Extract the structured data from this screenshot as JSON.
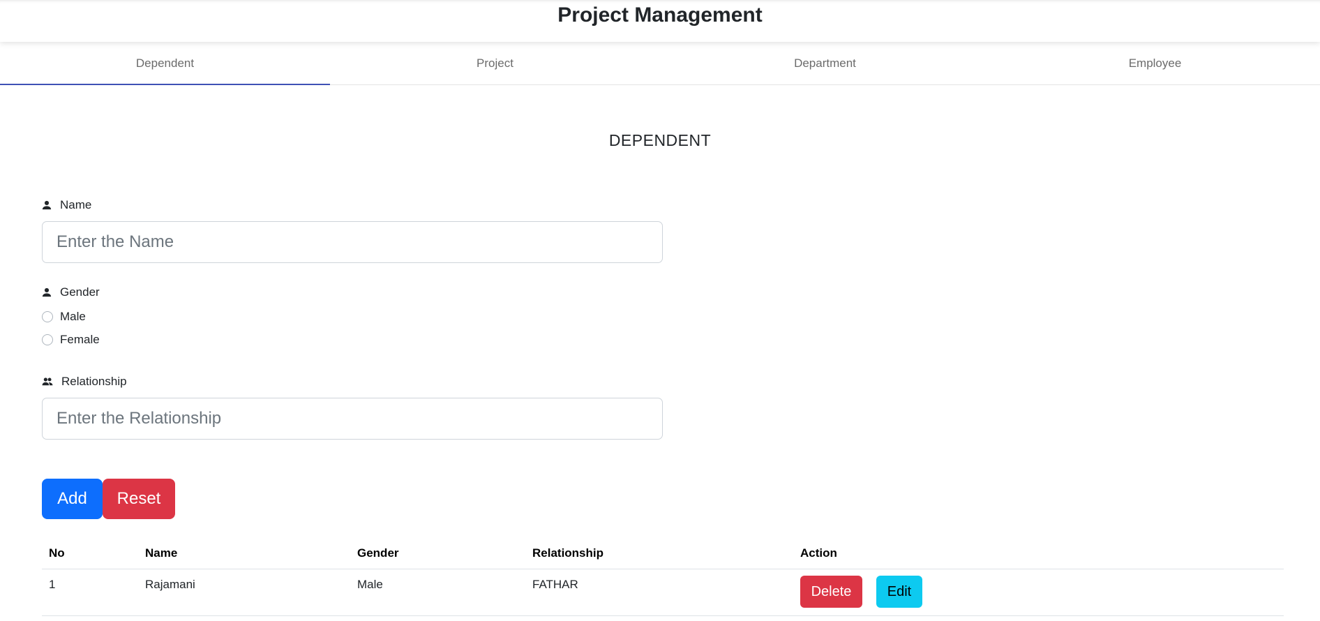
{
  "app": {
    "title": "Project Management"
  },
  "tabs": [
    {
      "label": "Dependent",
      "active": true
    },
    {
      "label": "Project",
      "active": false
    },
    {
      "label": "Department",
      "active": false
    },
    {
      "label": "Employee",
      "active": false
    }
  ],
  "form": {
    "section_title": "DEPENDENT",
    "name": {
      "label": "Name",
      "placeholder": "Enter the Name",
      "value": "",
      "icon": "person-icon"
    },
    "gender": {
      "label": "Gender",
      "icon": "person-icon",
      "options": [
        {
          "label": "Male",
          "checked": false
        },
        {
          "label": "Female",
          "checked": false
        }
      ]
    },
    "relationship": {
      "label": "Relationship",
      "placeholder": "Enter the Relationship",
      "value": "",
      "icon": "people-icon"
    },
    "buttons": {
      "add": "Add",
      "reset": "Reset"
    }
  },
  "table": {
    "headers": [
      "No",
      "Name",
      "Gender",
      "Relationship",
      "Action"
    ],
    "rows": [
      {
        "no": "1",
        "name": "Rajamani",
        "gender": "Male",
        "relationship": "FATHAR",
        "delete": "Delete",
        "edit": "Edit"
      }
    ]
  },
  "colors": {
    "primary": "#0d6efd",
    "danger": "#dc3545",
    "info": "#0dcaf0",
    "tab_indicator": "#3f51b5"
  }
}
